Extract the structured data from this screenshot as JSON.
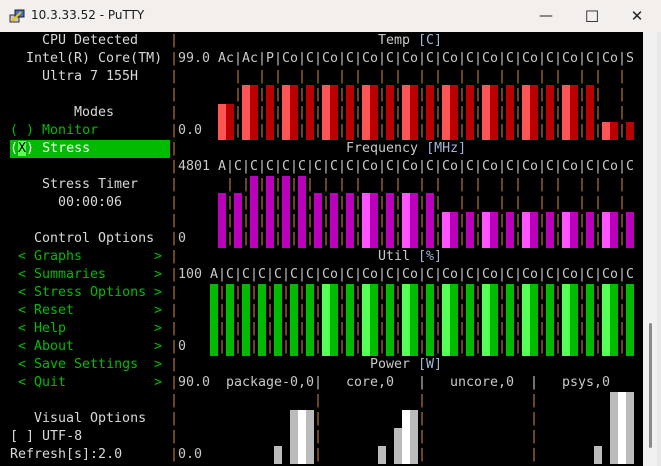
{
  "window": {
    "title": "10.3.33.52 - PuTTY",
    "minimize": "—",
    "maximize": "☐",
    "close": "✕"
  },
  "sidebar": {
    "cpu_header": "CPU Detected",
    "cpu_name_1": "Intel(R) Core(TM)",
    "cpu_name_2": "Ultra 7 155H",
    "modes_header": "Modes",
    "mode_monitor": {
      "radio": "( )",
      "label": "Monitor"
    },
    "mode_stress": {
      "radio_l": "(",
      "radio_x": "X",
      "radio_r": ")",
      "label": "Stress"
    },
    "timer_header": "Stress Timer",
    "timer_value": "00:00:06",
    "control_header": "Control Options",
    "menu": [
      "Graphs",
      "Summaries",
      "Stress Options",
      "Reset",
      "Help",
      "About",
      "Save Settings",
      "Quit"
    ],
    "menu_left": "<",
    "menu_right": ">",
    "visual_header": "Visual Options",
    "utf8_checkbox": "[ ]",
    "utf8_label": "UTF-8",
    "refresh": "Refresh[s]:2.0"
  },
  "colors": {
    "separator": "#c07a3a",
    "temp_light": "#ff5555",
    "temp_dark": "#bb0000",
    "freq_light": "#ff55ff",
    "freq_dark": "#bb00bb",
    "util_light": "#55ff55",
    "util_dark": "#00bb00",
    "power_grey": "#bbbbbb",
    "power_white": "#ffffff",
    "menu_green": "#00bb00"
  },
  "chart_data": [
    {
      "type": "bar",
      "title": "Temp",
      "unit": "[C]",
      "ymax_label": "99.0",
      "ymin_label": "0.0",
      "ylim": [
        0,
        99
      ],
      "categories": [
        "Ac",
        "Ac",
        "P",
        "Co",
        "C",
        "Co",
        "C",
        "Co",
        "C",
        "Co",
        "C",
        "Co",
        "C",
        "Co",
        "C",
        "Co",
        "C",
        "Co",
        "C",
        "Co",
        "S"
      ],
      "values": [
        50,
        75,
        75,
        75,
        75,
        75,
        75,
        75,
        75,
        75,
        75,
        75,
        75,
        75,
        75,
        75,
        75,
        75,
        75,
        25,
        25
      ]
    },
    {
      "type": "bar",
      "title": "Frequency",
      "unit": "[MHz]",
      "ymax_label": "4801",
      "ymin_label": "0",
      "ylim": [
        0,
        4801
      ],
      "categories": [
        "A",
        "C",
        "C",
        "C",
        "C",
        "C",
        "C",
        "C",
        "C",
        "Co",
        "C",
        "Co",
        "C",
        "Co",
        "C",
        "Co",
        "C",
        "Co",
        "C",
        "Co",
        "C",
        "Co",
        "C"
      ],
      "values": [
        3650,
        3650,
        4801,
        4801,
        4801,
        4801,
        3650,
        3650,
        3650,
        3650,
        3650,
        3650,
        3650,
        2400,
        2400,
        2400,
        2400,
        2400,
        2400,
        2400,
        2400,
        2400,
        2400
      ]
    },
    {
      "type": "bar",
      "title": "Util",
      "unit": "[%]",
      "ymax_label": "100",
      "ymin_label": "0",
      "ylim": [
        0,
        100
      ],
      "categories": [
        "A",
        "C",
        "C",
        "C",
        "C",
        "C",
        "C",
        "Co",
        "C",
        "Co",
        "C",
        "Co",
        "C",
        "Co",
        "C",
        "Co",
        "C",
        "Co",
        "C",
        "Co",
        "C",
        "Co",
        "C"
      ],
      "values": [
        100,
        100,
        100,
        100,
        100,
        100,
        100,
        100,
        100,
        100,
        100,
        100,
        100,
        100,
        100,
        100,
        100,
        100,
        100,
        100,
        100,
        100,
        100
      ]
    },
    {
      "type": "bar",
      "title": "Power",
      "unit": "[W]",
      "ymax_label": "90.0",
      "ymin_label": "0.0",
      "ylim": [
        0,
        90
      ],
      "series": [
        {
          "name": "package-0,0",
          "values": [
            22.5,
            0,
            67.5,
            67.5,
            67.5
          ],
          "shade": [
            "grey",
            "grey",
            "grey",
            "white",
            "grey"
          ]
        },
        {
          "name": "core,0",
          "values": [
            22.5,
            0,
            45,
            67.5,
            67.5
          ],
          "shade": [
            "grey",
            "grey",
            "grey",
            "white",
            "grey"
          ]
        },
        {
          "name": "uncore,0",
          "values": [],
          "shade": []
        },
        {
          "name": "psys,0",
          "values": [
            22.5,
            0,
            90,
            90,
            90
          ],
          "shade": [
            "grey",
            "grey",
            "grey",
            "white",
            "grey"
          ]
        }
      ]
    }
  ]
}
